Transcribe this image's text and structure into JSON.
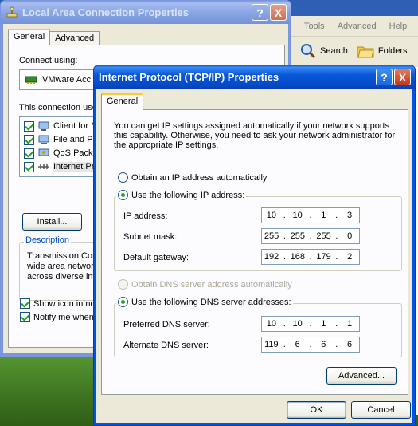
{
  "background_window": {
    "menu": [
      "Tools",
      "Advanced",
      "Help"
    ],
    "toolbar": {
      "search": "Search",
      "folders": "Folders"
    }
  },
  "lac": {
    "title": "Local Area Connection Properties",
    "tabs": [
      "General",
      "Advanced"
    ],
    "connect_using_label": "Connect using:",
    "adapter": "VMware Acc",
    "components_label": "This connection use",
    "components": [
      "Client for M",
      "File and Pr",
      "QoS Packe",
      "Internet Pr"
    ],
    "install_label": "Install...",
    "description_label": "Description",
    "description_lines": [
      "Transmission Con",
      "wide area networ",
      "across diverse int"
    ],
    "show_icon_label": "Show icon in not",
    "notify_label": "Notify me when"
  },
  "tcpip": {
    "title": "Internet Protocol (TCP/IP) Properties",
    "help_button": "?",
    "close_button": "X",
    "tab": "General",
    "intro_lines": [
      "You can get IP settings assigned automatically if your network supports",
      "this capability. Otherwise, you need to ask your network administrator for",
      "the appropriate IP settings."
    ],
    "obtain_ip_auto": "Obtain an IP address automatically",
    "use_following_ip": "Use the following IP address:",
    "ip_label": "IP address:",
    "ip": [
      "10",
      "10",
      "1",
      "3"
    ],
    "subnet_label": "Subnet mask:",
    "subnet": [
      "255",
      "255",
      "255",
      "0"
    ],
    "gateway_label": "Default gateway:",
    "gateway": [
      "192",
      "168",
      "179",
      "2"
    ],
    "obtain_dns_auto": "Obtain DNS server address automatically",
    "use_following_dns": "Use the following DNS server addresses:",
    "preferred_dns_label": "Preferred DNS server:",
    "preferred_dns": [
      "10",
      "10",
      "1",
      "1"
    ],
    "alternate_dns_label": "Alternate DNS server:",
    "alternate_dns": [
      "119",
      "6",
      "6",
      "6"
    ],
    "advanced_button": "Advanced...",
    "ok_button": "OK",
    "cancel_button": "Cancel"
  },
  "colors": {
    "titlebar_active": "#0054e3",
    "titlebar_inactive": "#7a96df",
    "dialog_face": "#ece9d8",
    "check_green": "#21a121"
  }
}
